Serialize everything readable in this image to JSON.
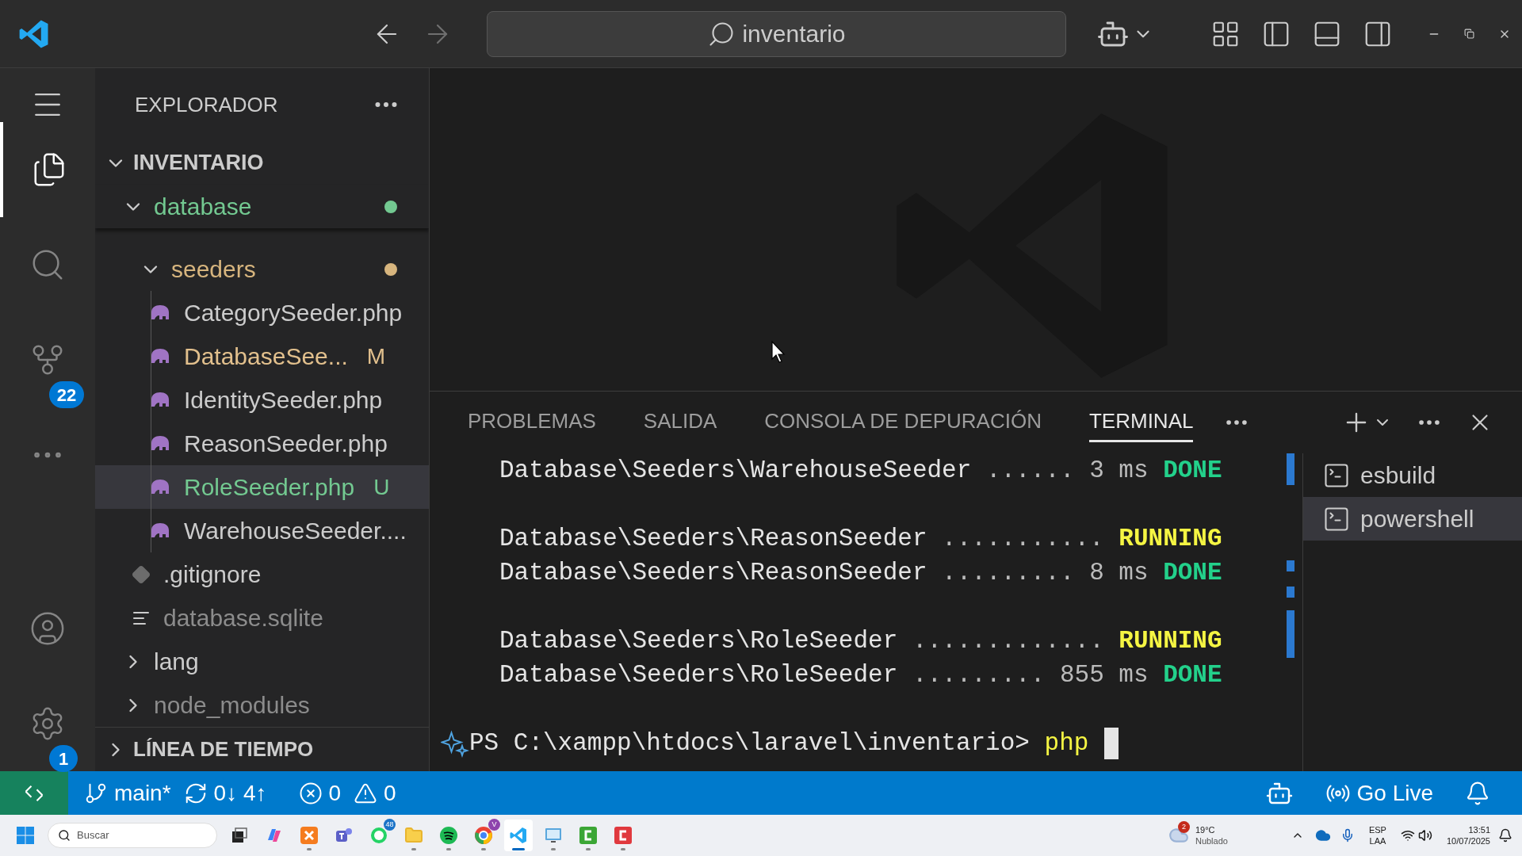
{
  "title_bar": {
    "search": "inventario"
  },
  "activity_bar": {
    "items": [
      {
        "kind": "explorer",
        "selected": true
      },
      {
        "kind": "search",
        "selected": false
      },
      {
        "kind": "scm",
        "selected": false,
        "badge": "22"
      },
      {
        "kind": "more",
        "selected": false
      }
    ],
    "bottom": [
      {
        "kind": "account"
      },
      {
        "kind": "settings",
        "badge": "1"
      }
    ]
  },
  "sidebar": {
    "title": "EXPLORADOR",
    "tree": [
      {
        "label": "INVENTARIO",
        "kind": "root",
        "expanded": true,
        "children": [
          {
            "label": "database",
            "kind": "folder",
            "expanded": true,
            "color": "#73c991",
            "dot": true,
            "children": [
              {
                "label": "seeders",
                "kind": "folder",
                "expanded": true,
                "color": "#d7b57e",
                "dot": true,
                "children": [
                  {
                    "label": "CategorySeeder.php",
                    "kind": "php",
                    "color": "#cccccc",
                    "selected": false
                  },
                  {
                    "label": "DatabaseSee...",
                    "kind": "php",
                    "color": "#e2c08d",
                    "badge": "M",
                    "selected": false
                  },
                  {
                    "label": "IdentitySeeder.php",
                    "kind": "php",
                    "color": "#cccccc",
                    "selected": false
                  },
                  {
                    "label": "ReasonSeeder.php",
                    "kind": "php",
                    "color": "#cccccc",
                    "selected": false
                  },
                  {
                    "label": "RoleSeeder.php",
                    "kind": "php",
                    "color": "#73c991",
                    "badge": "U",
                    "selected": true
                  },
                  {
                    "label": "WarehouseSeeder....",
                    "kind": "php",
                    "color": "#cccccc",
                    "selected": false
                  }
                ]
              },
              {
                "label": ".gitignore",
                "kind": "git",
                "color": "#cccccc",
                "selected": false
              },
              {
                "label": "database.sqlite",
                "kind": "text",
                "color": "#8c8c8c",
                "selected": false
              }
            ]
          },
          {
            "label": "lang",
            "kind": "folder",
            "expanded": false,
            "color": "#cccccc"
          },
          {
            "label": "node_modules",
            "kind": "folder",
            "expanded": false,
            "color": "#8c8c8c"
          }
        ]
      }
    ],
    "timeline": {
      "label": "LÍNEA DE TIEMPO",
      "expanded": false
    }
  },
  "panel": {
    "tabs": [
      {
        "label": "PROBLEMAS",
        "selected": false
      },
      {
        "label": "SALIDA",
        "selected": false
      },
      {
        "label": "CONSOLA DE DEPURACIÓN",
        "selected": false
      },
      {
        "label": "TERMINAL",
        "selected": true
      }
    ],
    "lines": [
      {
        "kind": "done",
        "name": "Database\\Seeders\\WarehouseSeeder",
        "dots": "......",
        "time": "3 ms",
        "status": "DONE"
      },
      {
        "kind": "blank"
      },
      {
        "kind": "running",
        "name": "Database\\Seeders\\ReasonSeeder",
        "dots": "...........",
        "status": "RUNNING"
      },
      {
        "kind": "done",
        "name": "Database\\Seeders\\ReasonSeeder",
        "dots": ".........",
        "time": "8 ms",
        "status": "DONE"
      },
      {
        "kind": "blank"
      },
      {
        "kind": "running",
        "name": "Database\\Seeders\\RoleSeeder",
        "dots": ".............",
        "status": "RUNNING"
      },
      {
        "kind": "done",
        "name": "Database\\Seeders\\RoleSeeder",
        "dots": ".........",
        "time": "855 ms",
        "status": "DONE"
      },
      {
        "kind": "blank"
      }
    ],
    "prompt": "PS C:\\xampp\\htdocs\\laravel\\inventario>",
    "command": "php",
    "terminals": [
      {
        "label": "esbuild",
        "selected": false
      },
      {
        "label": "powershell",
        "selected": true
      }
    ]
  },
  "status_bar": {
    "branch": "main*",
    "sync": "0↓ 4↑",
    "errors": "0",
    "warnings": "0",
    "go_live": "Go Live"
  },
  "taskbar": {
    "search_placeholder": "Buscar",
    "apps": [
      {
        "kind": "taskview"
      },
      {
        "kind": "copilot"
      },
      {
        "kind": "xampp",
        "running": true
      },
      {
        "kind": "teams"
      },
      {
        "kind": "whatsapp",
        "badge": "48"
      },
      {
        "kind": "files",
        "running": true
      },
      {
        "kind": "spotify",
        "running": true
      },
      {
        "kind": "chrome",
        "badge": "V",
        "running": true
      },
      {
        "kind": "vscode",
        "active": true
      },
      {
        "kind": "remote",
        "running": true
      },
      {
        "kind": "camtasia",
        "running": true
      },
      {
        "kind": "camtasia2",
        "running": true
      }
    ],
    "weather": {
      "temp": "19°C",
      "desc": "Nublado",
      "badge": "2"
    },
    "lang": "ESP",
    "layout": "LAA",
    "time": "13:51",
    "date": "10/07/2025"
  }
}
